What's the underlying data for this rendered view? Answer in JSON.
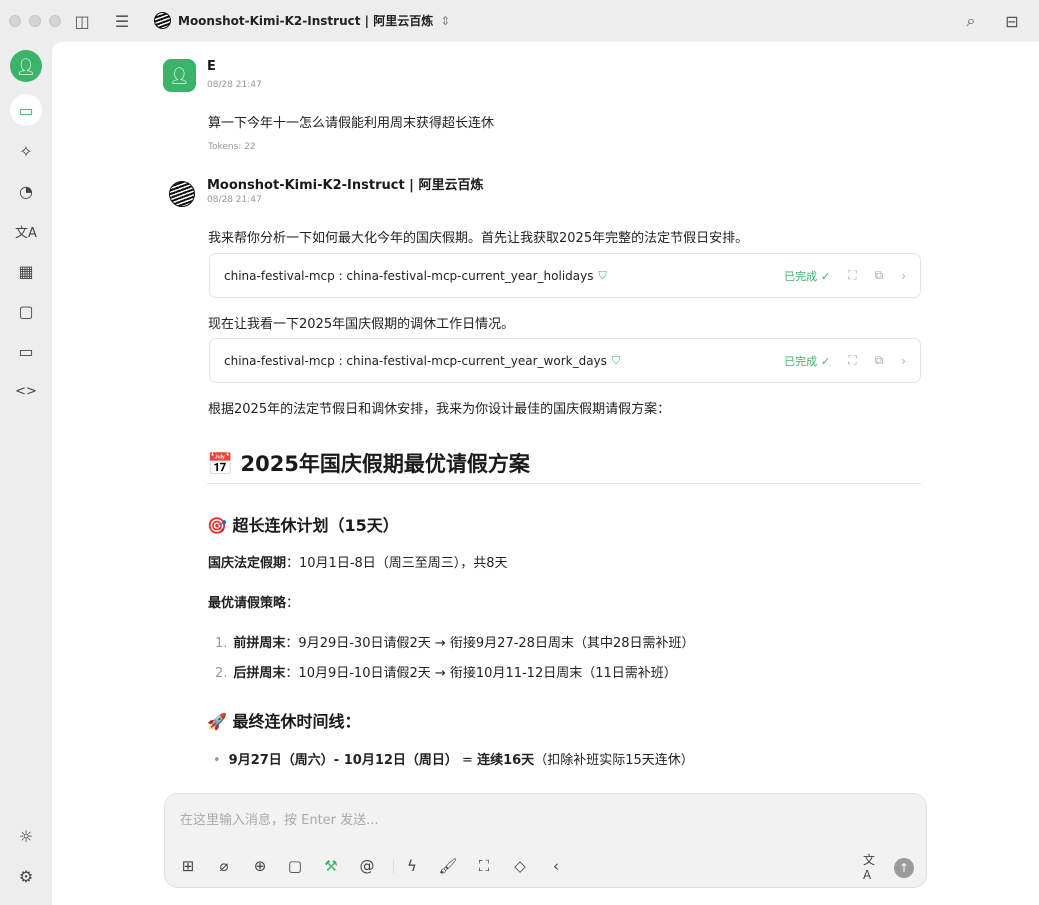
{
  "header": {
    "model_title": "Moonshot-Kimi-K2-Instruct | 阿里云百炼"
  },
  "user_msg": {
    "name": "E",
    "time": "08/28 21:47",
    "text": "算一下今年十一怎么请假能利用周末获得超长连休",
    "tokens": "Tokens: 22"
  },
  "bot_msg": {
    "name": "Moonshot-Kimi-K2-Instruct | 阿里云百炼",
    "time": "08/28 21:47",
    "p1": "我来帮你分析一下如何最大化今年的国庆假期。首先让我获取2025年完整的法定节假日安排。",
    "tool1": "china-festival-mcp : china-festival-mcp-current_year_holidays",
    "p2": "现在让我看一下2025年国庆假期的调休工作日情况。",
    "tool2": "china-festival-mcp : china-festival-mcp-current_year_work_days",
    "tool_status": "已完成",
    "p3": "根据2025年的法定节假日和调休安排，我来为你设计最佳的国庆假期请假方案：",
    "h1": "2025年国庆假期最优请假方案",
    "h1_emoji": "📅",
    "h3a": "超长连休计划（15天）",
    "h3a_emoji": "🎯",
    "legal_label": "国庆法定假期",
    "legal_text": "：10月1日-8日（周三至周三），共8天",
    "strategy_label": "最优请假策略",
    "strategy_colon": "：",
    "list": [
      {
        "num": "1.",
        "label": "前拼周末",
        "text": "：9月29日-30日请假2天 → 衔接9月27-28日周末（其中28日需补班）"
      },
      {
        "num": "2.",
        "label": "后拼周末",
        "text": "：10月9日-10日请假2天 → 衔接10月11-12日周末（11日需补班）"
      }
    ],
    "h3b": "最终连休时间线：",
    "h3b_emoji": "🚀",
    "bullet_bold": "9月27日（周六）- 10月12日（周日）",
    "bullet_eq": " = ",
    "bullet_bold2": "连续16天",
    "bullet_rest": "（扣除补班实际15天连休）"
  },
  "input": {
    "placeholder": "在这里输入消息，按 Enter 发送..."
  }
}
